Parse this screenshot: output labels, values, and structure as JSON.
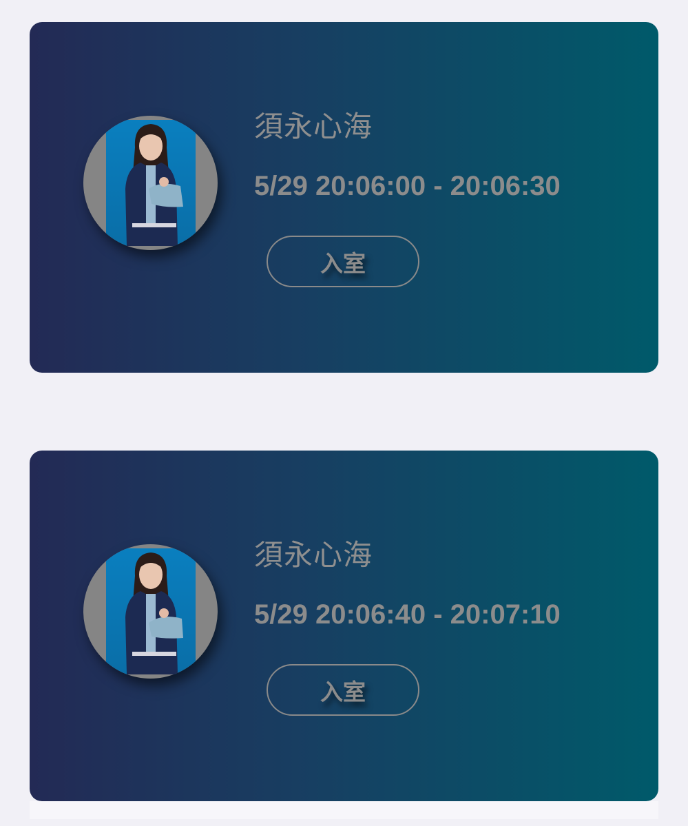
{
  "sessions": [
    {
      "member_name": "須永心海",
      "time_range": "5/29 20:06:00 - 20:06:30",
      "enter_label": "入室",
      "avatar_icon": "member-photo"
    },
    {
      "member_name": "須永心海",
      "time_range": "5/29 20:06:40 - 20:07:10",
      "enter_label": "入室",
      "avatar_icon": "member-photo"
    }
  ],
  "colors": {
    "page_background": "#f1f0f6",
    "card_gradient_start": "#232a55",
    "card_gradient_end": "#005a6a",
    "text_gray": "#8c8c8c"
  }
}
